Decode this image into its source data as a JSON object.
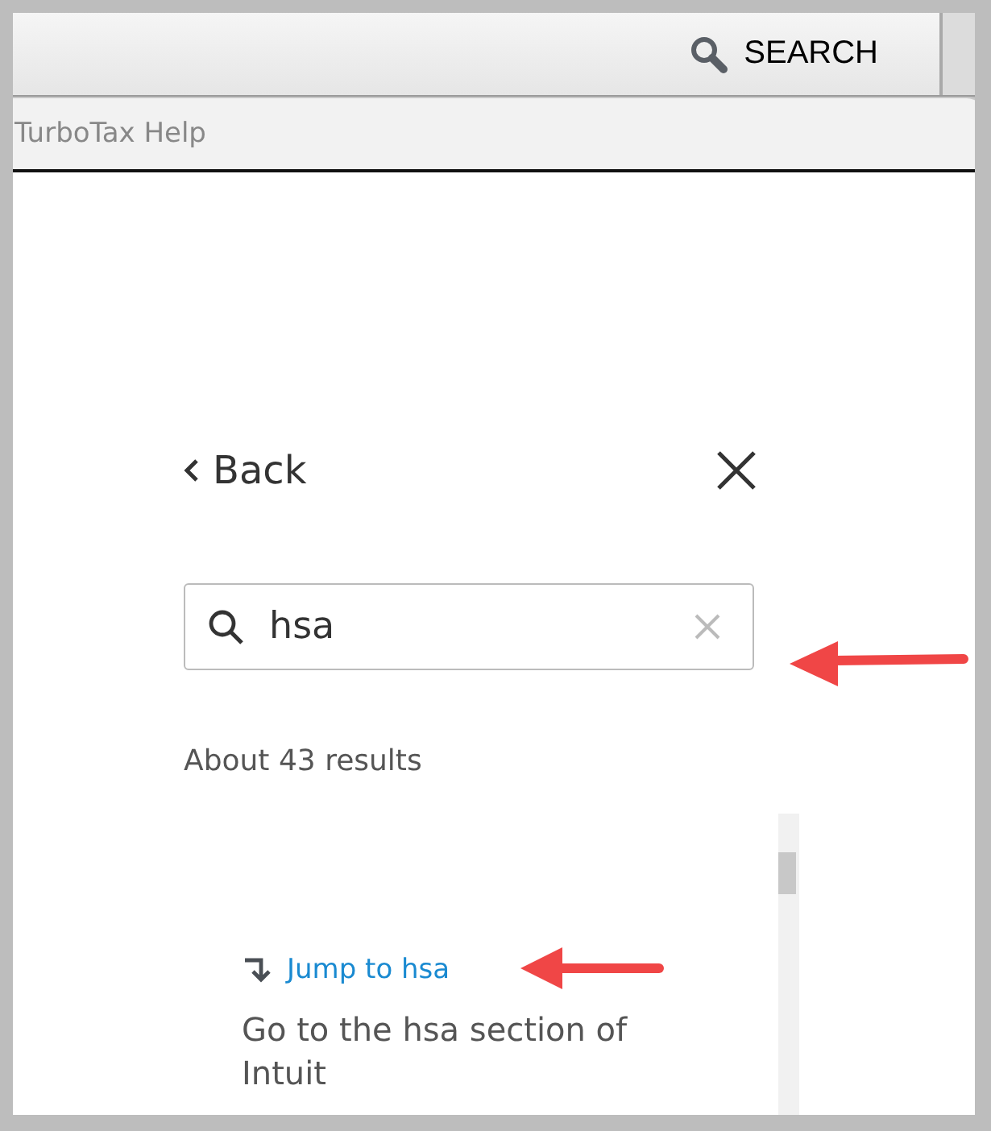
{
  "toolbar": {
    "search_label": "SEARCH"
  },
  "window": {
    "title": "TurboTax Help"
  },
  "help": {
    "back": "Back",
    "search": {
      "value": "hsa"
    },
    "result_count": "About 43 results",
    "results": [
      {
        "kind": "jump",
        "title": "Jump to hsa",
        "description": "Go to the hsa section of Intuit"
      }
    ]
  }
}
